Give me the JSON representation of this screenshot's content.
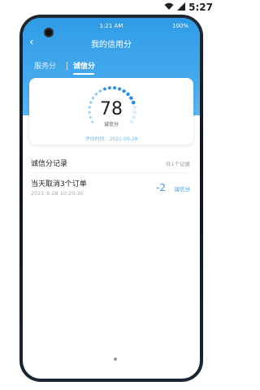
{
  "device": {
    "time": "5:27"
  },
  "app_status": {
    "time": "1:21 AM",
    "battery": "100%"
  },
  "nav": {
    "title": "我的信用分"
  },
  "tabs": [
    {
      "label": "服务分",
      "active": false
    },
    {
      "label": "诚信分",
      "active": true
    }
  ],
  "score_card": {
    "score": "78",
    "score_label": "诚信分",
    "eval_time": "评估时间：2021-09-28",
    "gauge_ratio": 0.78
  },
  "records": {
    "heading": "诚信分记录",
    "count": "共1个记录",
    "items": [
      {
        "title": "当天取消3个订单",
        "datetime": "2021-9-28 10:20:30",
        "delta": "-2",
        "unit": "诚信分"
      }
    ]
  },
  "colors": {
    "accent": "#2f9be6",
    "gauge_active_dark": "#2f8fdc",
    "gauge_active_light": "#8fcdf3",
    "gauge_inactive": "#dfeff9"
  }
}
